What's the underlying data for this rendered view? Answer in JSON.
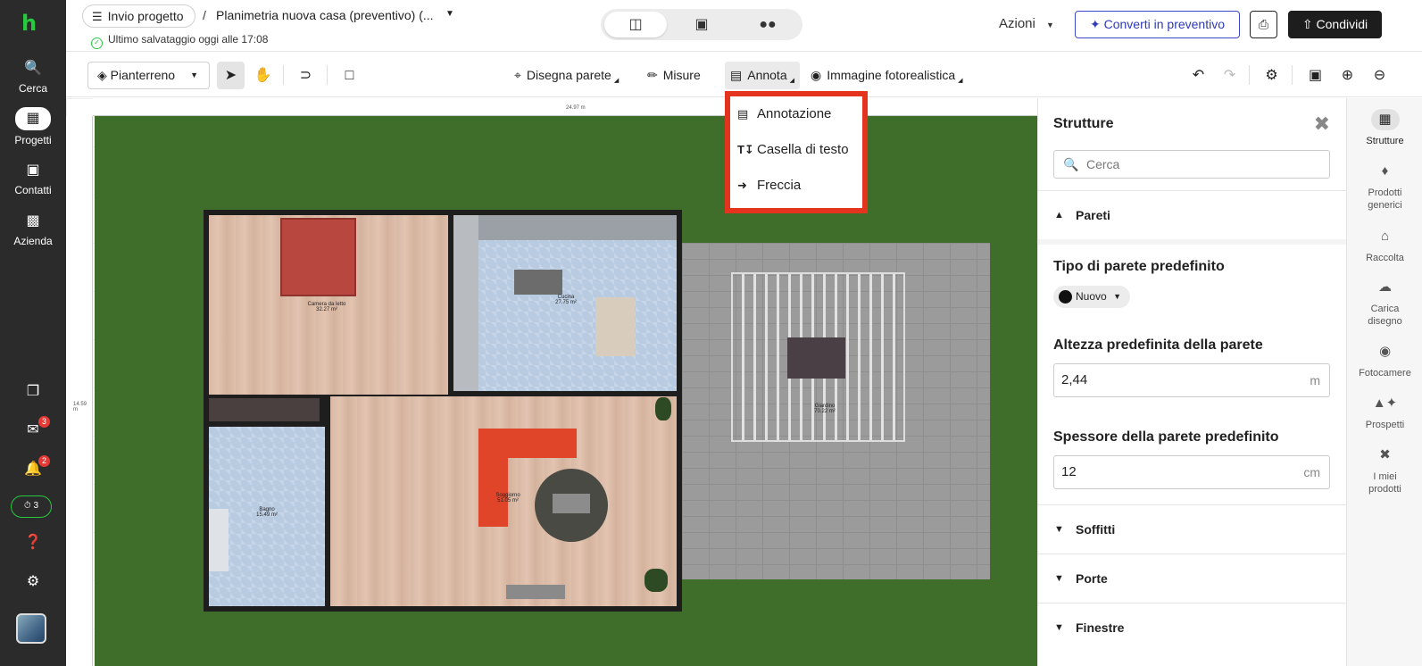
{
  "nav": {
    "logo_glyph": "h",
    "items": [
      {
        "label": "Cerca",
        "icon": "search-icon"
      },
      {
        "label": "Progetti",
        "icon": "projects-icon"
      },
      {
        "label": "Contatti",
        "icon": "contacts-icon"
      },
      {
        "label": "Azienda",
        "icon": "building-icon"
      }
    ],
    "messages_badge": "3",
    "notifications_badge": "2",
    "timer_count": "3"
  },
  "header": {
    "back_label": "Invio progetto",
    "separator": "/",
    "project_title": "Planimetria nuova casa (preventivo) (...",
    "save_status": "Ultimo salvataggio oggi alle 17:08",
    "actions_label": "Azioni",
    "convert_label": "Converti in preventivo",
    "share_label": "Condividi"
  },
  "toolbar": {
    "floor_label": "Pianterreno",
    "draw_wall": "Disegna parete",
    "measures": "Misure",
    "annotate": "Annota",
    "photo_image": "Immagine fotorealistica"
  },
  "annotate_menu": {
    "items": [
      {
        "label": "Annotazione",
        "icon": "annotation-icon"
      },
      {
        "label": "Casella di testo",
        "icon": "textbox-icon"
      },
      {
        "label": "Freccia",
        "icon": "arrow-icon"
      }
    ]
  },
  "canvas": {
    "ruler_top_label": "24.97 m",
    "ruler_left_label": "14.59 m",
    "rooms": {
      "bedroom": {
        "name": "Camera da letto",
        "area": "32.27 m²"
      },
      "kitchen": {
        "name": "Cucina",
        "area": "27.75 m²"
      },
      "bathroom": {
        "name": "Bagno",
        "area": "15.49 m²"
      },
      "living": {
        "name": "Soggiorno",
        "area": "51.05 m²"
      },
      "garden": {
        "name": "Giardino",
        "area": "70.22 m²"
      }
    }
  },
  "panel": {
    "title": "Strutture",
    "search_placeholder": "Cerca",
    "sections": {
      "walls": "Pareti",
      "ceilings": "Soffitti",
      "doors": "Porte",
      "windows": "Finestre"
    },
    "default_wall_type_label": "Tipo di parete predefinito",
    "wall_type_value": "Nuovo",
    "default_height_label": "Altezza predefinita della parete",
    "height_value": "2,44",
    "height_unit": "m",
    "default_thickness_label": "Spessore della parete predefinito",
    "thickness_value": "12",
    "thickness_unit": "cm"
  },
  "right_sidebar": {
    "items": [
      {
        "label": "Strutture"
      },
      {
        "label": "Prodotti generici"
      },
      {
        "label": "Raccolta"
      },
      {
        "label": "Carica disegno"
      },
      {
        "label": "Fotocamere"
      },
      {
        "label": "Prospetti"
      },
      {
        "label": "I miei prodotti"
      }
    ]
  }
}
